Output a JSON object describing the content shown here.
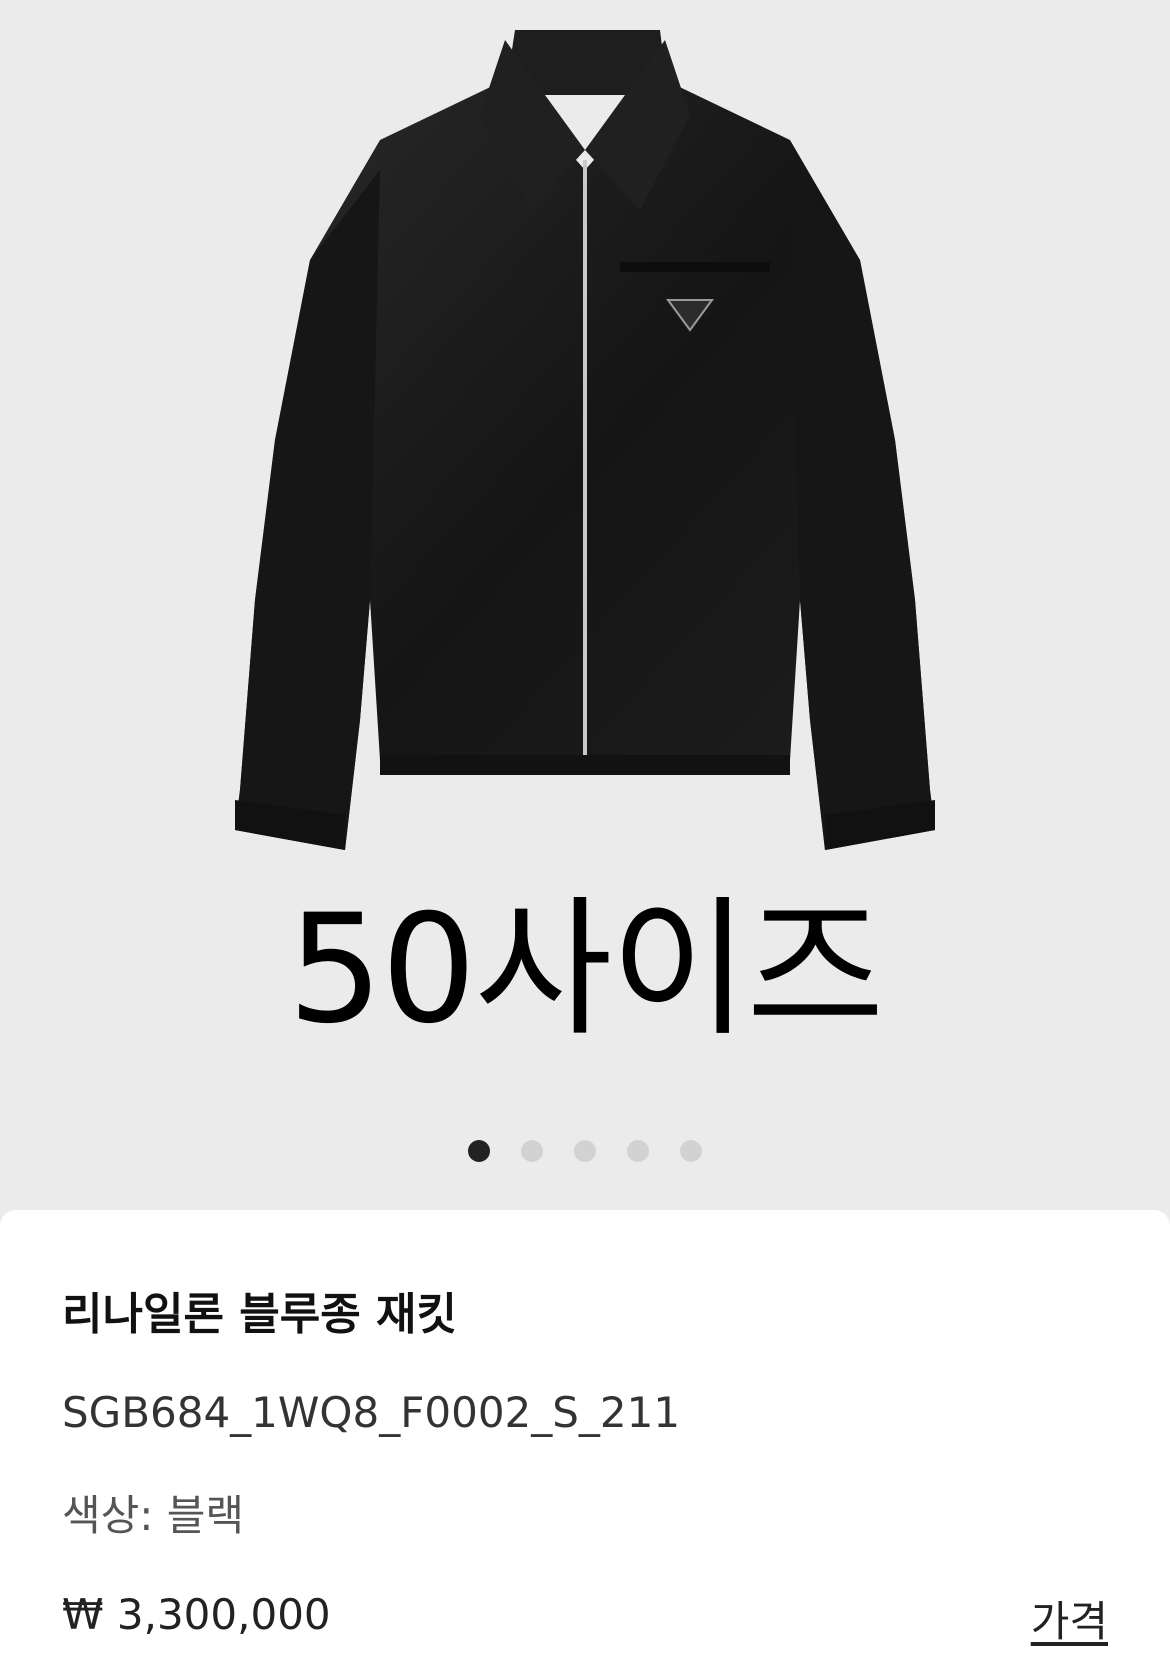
{
  "image": {
    "size_label": "50사이즈",
    "carousel": {
      "count": 5,
      "active_index": 0
    }
  },
  "product": {
    "name": "리나일론 블루종 재킷",
    "sku": "SGB684_1WQ8_F0002_S_211",
    "color_label": "색상:",
    "color_value": "블랙",
    "price": "₩ 3,300,000",
    "price_link": "가격"
  },
  "colors": {
    "background": "#ebebeb",
    "jacket": "#1a1a1a",
    "sheet": "#ffffff",
    "dot_active": "#222222",
    "dot_inactive": "#d2d2d2"
  }
}
